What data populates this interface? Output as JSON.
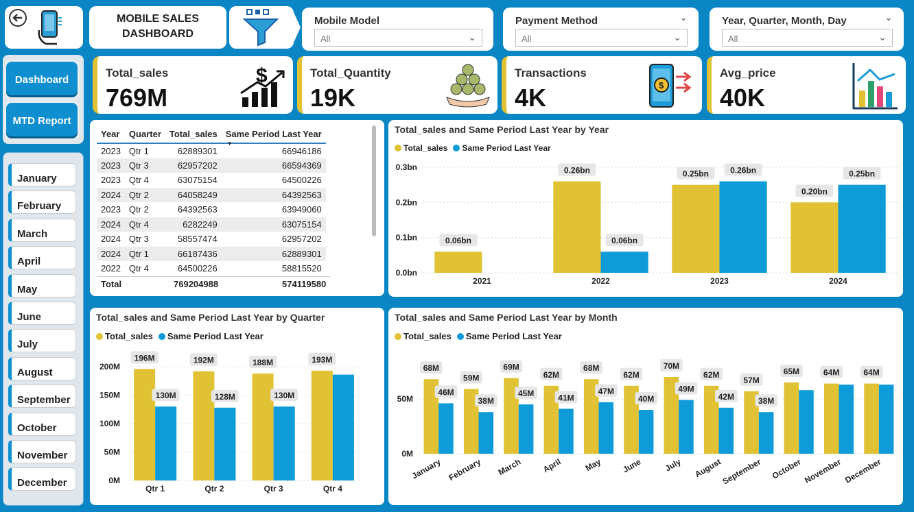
{
  "header": {
    "title_line1": "MOBILE SALES",
    "title_line2": "DASHBOARD",
    "icons": [
      "back-arrow-icon",
      "phone-hand-icon",
      "filter-funnel-icon"
    ]
  },
  "nav": {
    "dashboard": "Dashboard",
    "mtd_report": "MTD Report"
  },
  "slicers": [
    {
      "title": "Mobile Model",
      "value": "All"
    },
    {
      "title": "Payment Method",
      "value": "All"
    },
    {
      "title": "Year, Quarter, Month, Day",
      "value": "All"
    }
  ],
  "kpis": [
    {
      "label": "Total_sales",
      "value": "769M",
      "icon": "dollar-growth-icon"
    },
    {
      "label": "Total_Quantity",
      "value": "19K",
      "icon": "coins-hand-icon"
    },
    {
      "label": "Transactions",
      "value": "4K",
      "icon": "mobile-payment-icon"
    },
    {
      "label": "Avg_price",
      "value": "40K",
      "icon": "bar-chart-icon"
    }
  ],
  "months": [
    "January",
    "February",
    "March",
    "April",
    "May",
    "June",
    "July",
    "August",
    "September",
    "October",
    "November",
    "December"
  ],
  "table": {
    "headers": [
      "Year",
      "Quarter",
      "Total_sales",
      "Same Period Last Year"
    ],
    "rows": [
      [
        "2023",
        "Qtr 1",
        "62889301",
        "66946186"
      ],
      [
        "2023",
        "Qtr 3",
        "62957202",
        "66594369"
      ],
      [
        "2023",
        "Qtr 4",
        "63075154",
        "64500226"
      ],
      [
        "2024",
        "Qtr 2",
        "64058249",
        "64392563"
      ],
      [
        "2023",
        "Qtr 2",
        "64392563",
        "63949060"
      ],
      [
        "2024",
        "Qtr 4",
        "6282249",
        "63075154"
      ],
      [
        "2024",
        "Qtr 3",
        "58557474",
        "62957202"
      ],
      [
        "2024",
        "Qtr 1",
        "66187436",
        "62889301"
      ],
      [
        "2022",
        "Qtr 4",
        "64500226",
        "58815520"
      ]
    ],
    "total": [
      "Total",
      "",
      "769204988",
      "574119580"
    ]
  },
  "colors": {
    "total_sales": "#e0c234",
    "same_period": "#0f9bd7",
    "background": "#0a86c4"
  },
  "chart_data": [
    {
      "type": "bar",
      "title": "Total_sales and Same Period Last Year by Year",
      "categories": [
        "2021",
        "2022",
        "2023",
        "2024"
      ],
      "series": [
        {
          "name": "Total_sales",
          "values": [
            0.06,
            0.26,
            0.25,
            0.2
          ],
          "labels": [
            "0.06bn",
            "0.26bn",
            "0.25bn",
            "0.20bn"
          ]
        },
        {
          "name": "Same Period Last Year",
          "values": [
            null,
            0.06,
            0.26,
            0.25
          ],
          "labels": [
            "",
            "0.06bn",
            "0.26bn",
            "0.25bn"
          ]
        }
      ],
      "yticks": [
        "0.0bn",
        "0.1bn",
        "0.2bn",
        "0.3bn"
      ],
      "ylim": [
        0,
        0.3
      ]
    },
    {
      "type": "bar",
      "title": "Total_sales and Same Period Last Year by Quarter",
      "categories": [
        "Qtr 1",
        "Qtr 2",
        "Qtr 3",
        "Qtr 4"
      ],
      "series": [
        {
          "name": "Total_sales",
          "values": [
            196,
            192,
            188,
            193
          ],
          "labels": [
            "196M",
            "192M",
            "188M",
            "193M"
          ]
        },
        {
          "name": "Same Period Last Year",
          "values": [
            130,
            128,
            130,
            186
          ],
          "labels": [
            "130M",
            "128M",
            "130M",
            ""
          ]
        }
      ],
      "yticks": [
        "0M",
        "50M",
        "100M",
        "150M",
        "200M"
      ],
      "ylim": [
        0,
        200
      ]
    },
    {
      "type": "bar",
      "title": "Total_sales and Same Period Last Year by Month",
      "categories": [
        "January",
        "February",
        "March",
        "April",
        "May",
        "June",
        "July",
        "August",
        "September",
        "October",
        "November",
        "December"
      ],
      "series": [
        {
          "name": "Total_sales",
          "values": [
            68,
            59,
            69,
            62,
            68,
            62,
            70,
            62,
            57,
            65,
            64,
            64
          ],
          "labels": [
            "68M",
            "59M",
            "69M",
            "62M",
            "68M",
            "62M",
            "70M",
            "62M",
            "57M",
            "65M",
            "64M",
            "64M"
          ]
        },
        {
          "name": "Same Period Last Year",
          "values": [
            46,
            38,
            45,
            41,
            47,
            40,
            49,
            42,
            38,
            58,
            63,
            63
          ],
          "labels": [
            "46M",
            "38M",
            "45M",
            "41M",
            "47M",
            "40M",
            "49M",
            "42M",
            "38M",
            "",
            "",
            ""
          ]
        }
      ],
      "yticks": [
        "0M",
        "50M"
      ],
      "ylim": [
        0,
        80
      ]
    }
  ]
}
